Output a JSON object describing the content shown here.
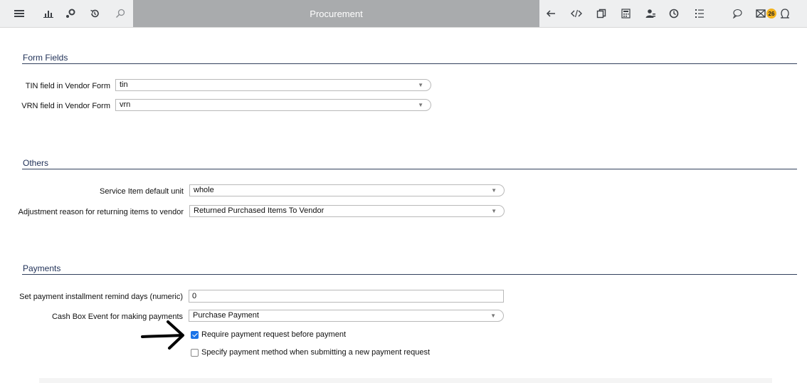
{
  "header": {
    "title": "Procurement",
    "notification_count": "26",
    "left_icons": [
      "menu-icon",
      "chart-icon",
      "tools-icon",
      "history-icon",
      "search-icon"
    ],
    "right_icons": [
      "back-arrow-icon",
      "code-icon",
      "copy-icon",
      "calculator-icon",
      "users-icon",
      "clock-icon",
      "list-icon",
      "comment-icon",
      "mail-icon",
      "user-icon"
    ]
  },
  "sections": {
    "form_fields": {
      "title": "Form Fields",
      "tin_label": "TIN field in Vendor Form",
      "tin_value": "tin",
      "vrn_label": "VRN field in Vendor Form",
      "vrn_value": "vrn"
    },
    "others": {
      "title": "Others",
      "service_unit_label": "Service Item default unit",
      "service_unit_value": "whole",
      "adjustment_label": "Adjustment reason for returning items to vendor",
      "adjustment_value": "Returned Purchased Items To Vendor"
    },
    "payments": {
      "title": "Payments",
      "remind_days_label": "Set payment installment remind days (numeric)",
      "remind_days_value": "0",
      "cash_box_label": "Cash Box Event for making payments",
      "cash_box_value": "Purchase Payment",
      "require_request_label": "Require payment request before payment",
      "require_request_checked": true,
      "specify_method_label": "Specify payment method when submitting a new payment request",
      "specify_method_checked": false
    }
  },
  "colors": {
    "title_bar": "#a9abad",
    "section_title": "#1e2f56",
    "badge": "#f3b21b",
    "checkbox_checked": "#1a73e8"
  }
}
